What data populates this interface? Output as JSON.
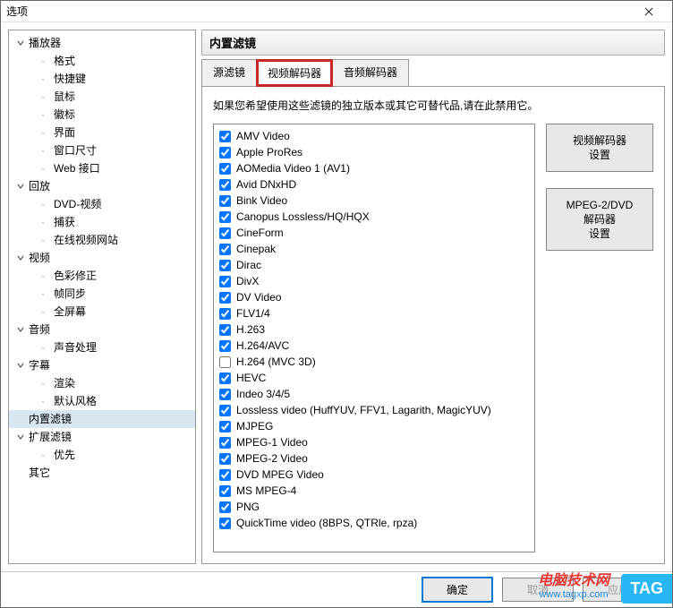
{
  "window": {
    "title": "选项"
  },
  "sidebar": {
    "groups": [
      {
        "label": "播放器",
        "expanded": true,
        "items": [
          "格式",
          "快捷键",
          "鼠标",
          "徽标",
          "界面",
          "窗口尺寸",
          "Web 接口"
        ]
      },
      {
        "label": "回放",
        "expanded": true,
        "items": [
          "DVD-视频",
          "捕获",
          "在线视频网站"
        ]
      },
      {
        "label": "视频",
        "expanded": true,
        "items": [
          "色彩修正",
          "帧同步",
          "全屏幕"
        ]
      },
      {
        "label": "音频",
        "expanded": true,
        "items": [
          "声音处理"
        ]
      },
      {
        "label": "字幕",
        "expanded": true,
        "items": [
          "渲染",
          "默认风格"
        ]
      },
      {
        "label": "内置滤镜",
        "expanded": false,
        "items": [],
        "selected": true
      },
      {
        "label": "扩展滤镜",
        "expanded": true,
        "items": [
          "优先"
        ]
      },
      {
        "label": "其它",
        "expanded": false,
        "items": []
      }
    ]
  },
  "panel": {
    "title": "内置滤镜",
    "tabs": [
      "源滤镜",
      "视频解码器",
      "音频解码器"
    ],
    "activeTab": 1,
    "highlightedTab": 1,
    "description": "如果您希望使用这些滤镜的独立版本或其它可替代品,请在此禁用它。"
  },
  "codecs": [
    {
      "label": "AMV Video",
      "checked": true
    },
    {
      "label": "Apple ProRes",
      "checked": true
    },
    {
      "label": "AOMedia Video 1 (AV1)",
      "checked": true
    },
    {
      "label": "Avid DNxHD",
      "checked": true
    },
    {
      "label": "Bink Video",
      "checked": true
    },
    {
      "label": "Canopus Lossless/HQ/HQX",
      "checked": true
    },
    {
      "label": "CineForm",
      "checked": true
    },
    {
      "label": "Cinepak",
      "checked": true
    },
    {
      "label": "Dirac",
      "checked": true
    },
    {
      "label": "DivX",
      "checked": true
    },
    {
      "label": "DV Video",
      "checked": true
    },
    {
      "label": "FLV1/4",
      "checked": true
    },
    {
      "label": "H.263",
      "checked": true
    },
    {
      "label": "H.264/AVC",
      "checked": true
    },
    {
      "label": "H.264 (MVC 3D)",
      "checked": false
    },
    {
      "label": "HEVC",
      "checked": true
    },
    {
      "label": "Indeo 3/4/5",
      "checked": true
    },
    {
      "label": "Lossless video (HuffYUV, FFV1, Lagarith, MagicYUV)",
      "checked": true
    },
    {
      "label": "MJPEG",
      "checked": true
    },
    {
      "label": "MPEG-1 Video",
      "checked": true
    },
    {
      "label": "MPEG-2 Video",
      "checked": true
    },
    {
      "label": "DVD MPEG Video",
      "checked": true
    },
    {
      "label": "MS MPEG-4",
      "checked": true
    },
    {
      "label": "PNG",
      "checked": true
    },
    {
      "label": "QuickTime video (8BPS, QTRle, rpza)",
      "checked": true
    }
  ],
  "sideButtons": [
    "视频解码器\n设置",
    "MPEG-2/DVD\n解码器\n设置"
  ],
  "footer": {
    "ok": "确定",
    "cancel": "取消",
    "apply": "应用"
  },
  "watermark": {
    "line1": "电脑技术网",
    "line2": "www.tagxp.com",
    "badge": "TAG"
  }
}
